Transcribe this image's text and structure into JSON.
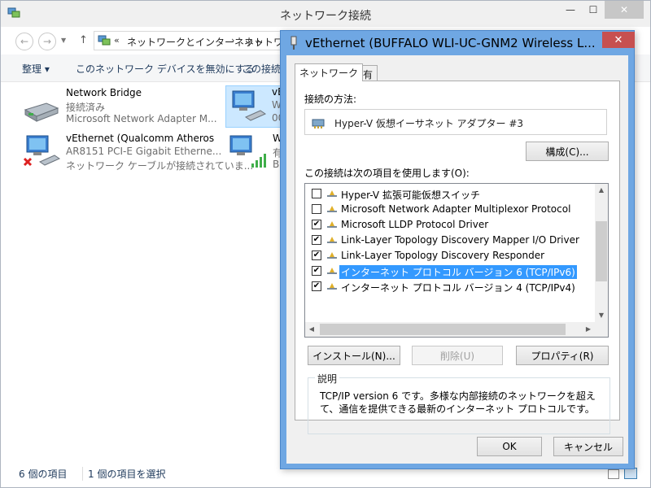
{
  "window": {
    "title": "ネットワーク接続",
    "min_glyph": "—",
    "max_glyph": "☐",
    "close_glyph": "✕"
  },
  "address": {
    "back_glyph": "←",
    "fwd_glyph": "→",
    "up_glyph": "↑",
    "chevron": "«",
    "segment1": "ネットワークとインターネット",
    "separator": "›",
    "segment2": "ネットワーク接続"
  },
  "commandbar": {
    "organize": "整理 ▾",
    "disable_device": "このネットワーク デバイスを無効にする",
    "rename": "この接続の名前を変更する"
  },
  "connections": [
    {
      "name": "Network Bridge",
      "status": "接続済み",
      "device": "Microsoft Network Adapter M..."
    },
    {
      "name": "vEthernet (Qualcomm Atheros",
      "status": "AR8151 PCI-E Gigabit Etherne...",
      "device": "ネットワーク ケーブルが接続されていま..."
    },
    {
      "name": "vE",
      "status": "W",
      "device": "00"
    },
    {
      "name": "W",
      "status": "有",
      "device": "BU"
    }
  ],
  "statusbar": {
    "count": "6 個の項目",
    "selected": "1 個の項目を選択"
  },
  "dialog": {
    "title": "vEthernet (BUFFALO WLI-UC-GNM2 Wireless L...",
    "close_glyph": "✕",
    "tabs": [
      "ネットワーク",
      "共有"
    ],
    "connect_using_label": "接続の方法:",
    "adapter": "Hyper-V 仮想イーサネット アダプター #3",
    "configure": "構成(C)...",
    "items_label": "この接続は次の項目を使用します(O):",
    "components": [
      {
        "checked": false,
        "label": "Hyper-V 拡張可能仮想スイッチ"
      },
      {
        "checked": false,
        "label": "Microsoft Network Adapter Multiplexor Protocol"
      },
      {
        "checked": true,
        "label": "Microsoft LLDP Protocol Driver"
      },
      {
        "checked": true,
        "label": "Link-Layer Topology Discovery Mapper I/O Driver"
      },
      {
        "checked": true,
        "label": "Link-Layer Topology Discovery Responder"
      },
      {
        "checked": true,
        "label": "インターネット プロトコル バージョン 6 (TCP/IPv6)",
        "selected": true
      },
      {
        "checked": true,
        "label": "インターネット プロトコル バージョン 4 (TCP/IPv4)"
      }
    ],
    "check_glyph": "✔",
    "scroll_up": "▲",
    "scroll_down": "▼",
    "scroll_left": "◀",
    "scroll_right": "▶",
    "install": "インストール(N)...",
    "uninstall": "削除(U)",
    "properties": "プロパティ(R)",
    "description_legend": "説明",
    "description": "TCP/IP version 6 です。多様な内部接続のネットワークを超えて、通信を提供できる最新のインターネット プロトコルです。",
    "ok": "OK",
    "cancel": "キャンセル"
  },
  "icons": {
    "app": "network-connections-icon",
    "network_adapter": "network-adapter-icon",
    "bridge": "network-bridge-icon",
    "disconnected": "red-x-icon",
    "wireless_signal": "signal-bars-icon",
    "dialog_app": "vethernet-icon",
    "component": "protocol-icon"
  },
  "colors": {
    "dialog_frame": "#6fa7e3",
    "selection": "#3399ff",
    "item_selected_bg": "#cce8ff",
    "close_red": "#c75050"
  }
}
